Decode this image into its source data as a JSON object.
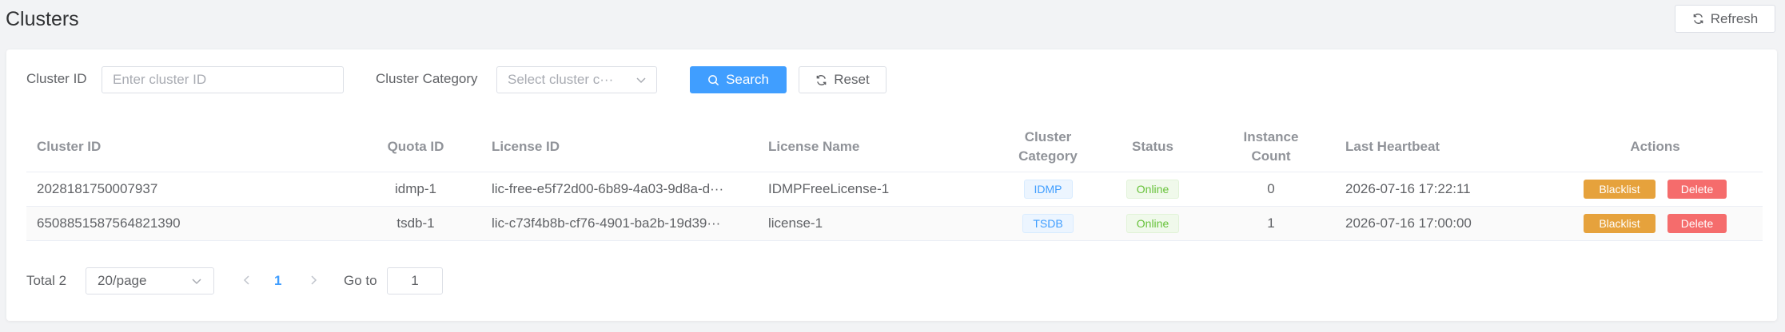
{
  "page": {
    "title": "Clusters",
    "refresh_label": "Refresh"
  },
  "filters": {
    "cluster_id_label": "Cluster ID",
    "cluster_id_placeholder": "Enter cluster ID",
    "category_label": "Cluster Category",
    "category_placeholder": "Select cluster c···",
    "search_label": "Search",
    "reset_label": "Reset"
  },
  "table": {
    "headers": {
      "cluster_id": "Cluster ID",
      "quota_id": "Quota ID",
      "license_id": "License ID",
      "license_name": "License Name",
      "category_line1": "Cluster",
      "category_line2": "Category",
      "status": "Status",
      "instance_line1": "Instance",
      "instance_line2": "Count",
      "last_heartbeat": "Last Heartbeat",
      "actions": "Actions"
    },
    "rows": [
      {
        "cluster_id": "2028181750007937",
        "quota_id": "idmp-1",
        "license_id": "lic-free-e5f72d00-6b89-4a03-9d8a-d···",
        "license_name": "IDMPFreeLicense-1",
        "category": "IDMP",
        "status": "Online",
        "instance_count": "0",
        "last_heartbeat": "2026-07-16 17:22:11",
        "blacklist_label": "Blacklist",
        "delete_label": "Delete"
      },
      {
        "cluster_id": "6508851587564821390",
        "quota_id": "tsdb-1",
        "license_id": "lic-c73f4b8b-cf76-4901-ba2b-19d39···",
        "license_name": "license-1",
        "category": "TSDB",
        "status": "Online",
        "instance_count": "1",
        "last_heartbeat": "2026-07-16 17:00:00",
        "blacklist_label": "Blacklist",
        "delete_label": "Delete"
      }
    ]
  },
  "pagination": {
    "total_label": "Total 2",
    "page_size": "20/page",
    "current_page": "1",
    "goto_label": "Go to",
    "goto_value": "1"
  },
  "colors": {
    "primary": "#409eff",
    "warning": "#e6a23c",
    "danger": "#f56c6c",
    "success": "#67c23a"
  }
}
